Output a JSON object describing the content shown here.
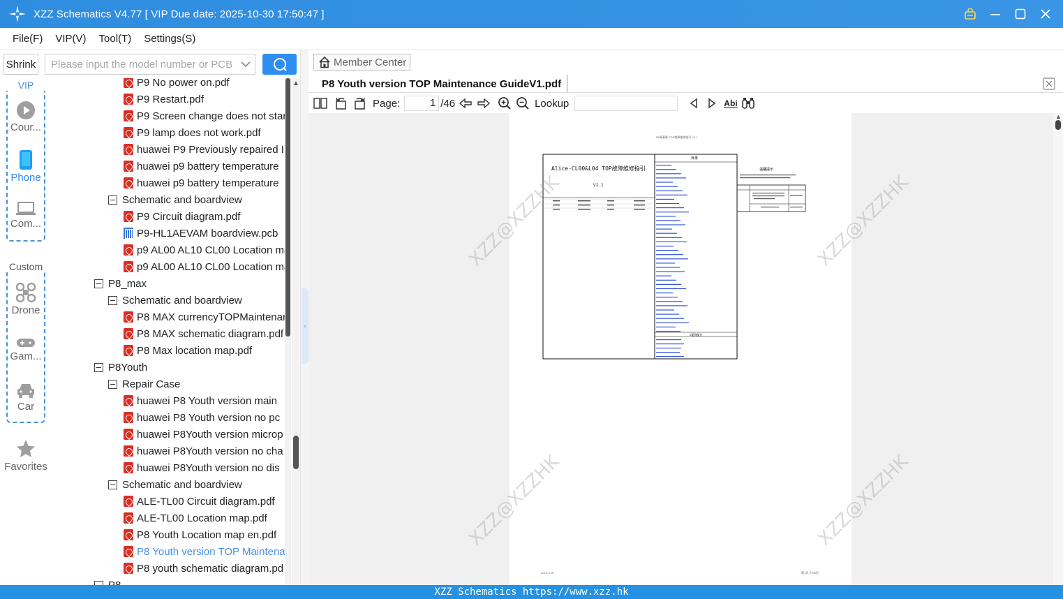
{
  "window": {
    "title": "XZZ Schematics V4.77 [ VIP Due date: 2025-10-30 17:50:47 ]"
  },
  "menu": [
    "File(F)",
    "VIP(V)",
    "Tool(T)",
    "Settings(S)"
  ],
  "left_toolbar": {
    "shrink_label": "Shrink",
    "search_placeholder": "Please input the model number or PCB"
  },
  "rail": {
    "vip_label": "VIP",
    "custom_label": "Custom",
    "items": [
      {
        "label": "Cour...",
        "icon": "play-icon"
      },
      {
        "label": "Phone",
        "icon": "phone-icon"
      },
      {
        "label": "Com...",
        "icon": "laptop-icon"
      },
      {
        "label": "Drone",
        "icon": "drone-icon"
      },
      {
        "label": "Gam...",
        "icon": "gamepad-icon"
      },
      {
        "label": "Car",
        "icon": "car-icon"
      },
      {
        "label": "Favorites",
        "icon": "star-icon"
      }
    ]
  },
  "tree": {
    "rows": [
      {
        "label": "P9 No power on.pdf",
        "kind": "pdf",
        "level": 2
      },
      {
        "label": "P9 Restart.pdf",
        "kind": "pdf",
        "level": 2
      },
      {
        "label": "P9 Screen change does not star",
        "kind": "pdf",
        "level": 2
      },
      {
        "label": "P9 lamp does not work.pdf",
        "kind": "pdf",
        "level": 2
      },
      {
        "label": "huawei P9 Previously repaired I",
        "kind": "pdf",
        "level": 2
      },
      {
        "label": "huawei p9 battery temperature",
        "kind": "pdf",
        "level": 2
      },
      {
        "label": "huawei p9 battery temperature",
        "kind": "pdf",
        "level": 2
      },
      {
        "label": "Schematic and boardview",
        "kind": "folder",
        "level": 1
      },
      {
        "label": "P9 Circuit diagram.pdf",
        "kind": "pdf",
        "level": 2
      },
      {
        "label": "P9-HL1AEVAM boardview.pcb",
        "kind": "pcb",
        "level": 2
      },
      {
        "label": "p9 AL00 AL10 CL00 Location ma",
        "kind": "pdf",
        "level": 2
      },
      {
        "label": "p9 AL00 AL10 CL00 Location ma",
        "kind": "pdf",
        "level": 2
      },
      {
        "label": "P8_max",
        "kind": "folder",
        "level": 0
      },
      {
        "label": "Schematic and boardview",
        "kind": "folder",
        "level": 1
      },
      {
        "label": "P8 MAX currencyTOPMaintenar",
        "kind": "pdf",
        "level": 2
      },
      {
        "label": "P8 MAX schematic diagram.pdf",
        "kind": "pdf",
        "level": 2
      },
      {
        "label": "P8 Max location map.pdf",
        "kind": "pdf",
        "level": 2
      },
      {
        "label": "P8Youth",
        "kind": "folder",
        "level": 0
      },
      {
        "label": "Repair Case",
        "kind": "folder",
        "level": 1
      },
      {
        "label": "huawei P8 Youth version  main",
        "kind": "pdf",
        "level": 2
      },
      {
        "label": "huawei P8 Youth version  no pc",
        "kind": "pdf",
        "level": 2
      },
      {
        "label": "huawei P8Youth version  microp",
        "kind": "pdf",
        "level": 2
      },
      {
        "label": "huawei P8Youth version  no cha",
        "kind": "pdf",
        "level": 2
      },
      {
        "label": "huawei P8Youth version  no dis",
        "kind": "pdf",
        "level": 2
      },
      {
        "label": "Schematic and boardview",
        "kind": "folder",
        "level": 1
      },
      {
        "label": "ALE-TL00 Circuit diagram.pdf",
        "kind": "pdf",
        "level": 2
      },
      {
        "label": "ALE-TL00 Location map.pdf",
        "kind": "pdf",
        "level": 2
      },
      {
        "label": "P8 Youth Location map en.pdf",
        "kind": "pdf",
        "level": 2
      },
      {
        "label": "P8 Youth version TOP Maintena",
        "kind": "pdf",
        "level": 2,
        "selected": true
      },
      {
        "label": "P8 youth schematic diagram.pd",
        "kind": "pdf",
        "level": 2
      },
      {
        "label": "P8",
        "kind": "folder",
        "level": 0
      }
    ]
  },
  "viewer": {
    "member_center": "Member Center",
    "doc_tab_title": "P8 Youth version TOP Maintenance GuideV1.pdf",
    "page_label": "Page:",
    "page_current": "1",
    "page_total": "/46",
    "lookup_label": "Lookup",
    "lookup_value": "",
    "doc": {
      "header_text": "P8青春版 TOP故障维修指引 V1.1",
      "box_title": "Alice-CL00&L04 TOP故障维修指引",
      "box_version": "V1.1",
      "toc_title": "目录",
      "toc_section2": "4案例部分",
      "notice_title": "温馨提示",
      "footer_left": "2015-3-26",
      "footer_right": "第1页, 共46页"
    },
    "watermark": "XZZ@XZZHK"
  },
  "status_bar": "XZZ Schematics https://www.xzz.hk",
  "colors": {
    "titlebar": "#2f8de0",
    "accent": "#2d8ef0",
    "selected_text": "#4a90e2",
    "pdf_icon": "#d93025"
  }
}
